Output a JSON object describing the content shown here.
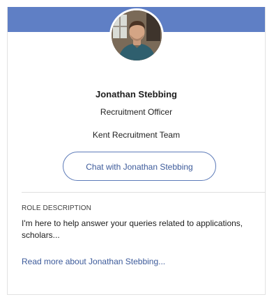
{
  "profile": {
    "name": "Jonathan Stebbing",
    "role": "Recruitment Officer",
    "team": "Kent Recruitment Team",
    "chat_button_label": "Chat with Jonathan Stebbing",
    "avatar_alt": "Jonathan Stebbing"
  },
  "role_description": {
    "title": "ROLE DESCRIPTION",
    "text": "I'm here to help answer your queries related to applications, scholars...",
    "read_more_label": "Read more about Jonathan Stebbing..."
  },
  "colors": {
    "banner": "#5f7fc5",
    "accent": "#3c5a9a",
    "button_border": "#5c7ab8"
  }
}
